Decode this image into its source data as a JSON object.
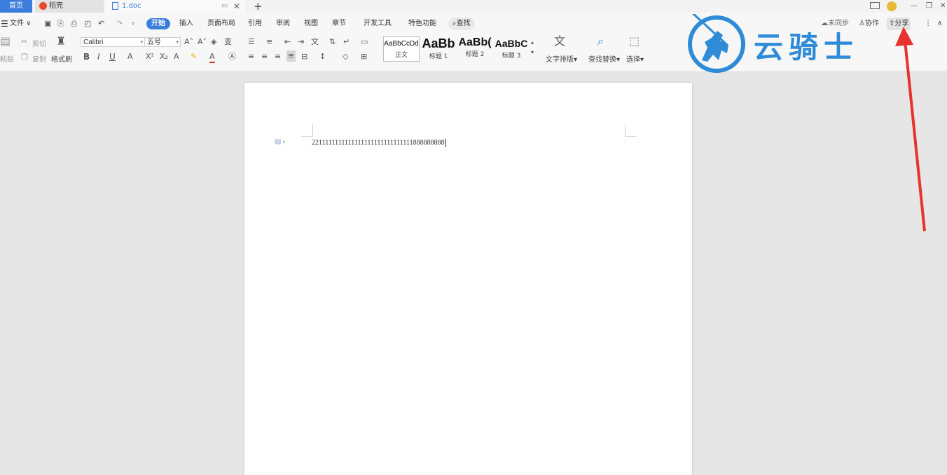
{
  "tabs": {
    "home": "首页",
    "daoke": "稻壳",
    "doc": "1.doc",
    "new_tab": "+"
  },
  "menu": {
    "file": "文件",
    "items": [
      "开始",
      "插入",
      "页面布局",
      "引用",
      "审阅",
      "视图",
      "章节",
      "开发工具",
      "特色功能"
    ],
    "search": "查找",
    "sync": "未同步",
    "collab": "协作",
    "share": "分享"
  },
  "ribbon": {
    "paste": "粘贴",
    "cut": "剪切",
    "copy": "复制",
    "format_painter": "格式刷",
    "font_name": "Calibri",
    "font_size": "五号",
    "styles": [
      {
        "preview": "AaBbCcDd",
        "name": "正文"
      },
      {
        "preview": "AaBb",
        "name": "标题 1"
      },
      {
        "preview": "AaBb(",
        "name": "标题 2"
      },
      {
        "preview": "AaBbC",
        "name": "标题 3"
      }
    ],
    "text_layout": "文字排版",
    "find_replace": "查找替换",
    "select": "选择"
  },
  "document": {
    "text": "2211111111111111111111111111111888888888"
  },
  "watermark": {
    "text": "云骑士"
  },
  "colors": {
    "accent": "#3b7ddd",
    "brand": "#2f8bd8",
    "arrow": "#e8322d"
  },
  "icons": [
    "menu-icon",
    "save-icon",
    "undo-icon",
    "redo-icon",
    "search-icon",
    "cloud-icon",
    "user-icon",
    "share-icon",
    "bold-icon",
    "italic-icon",
    "underline-icon"
  ]
}
